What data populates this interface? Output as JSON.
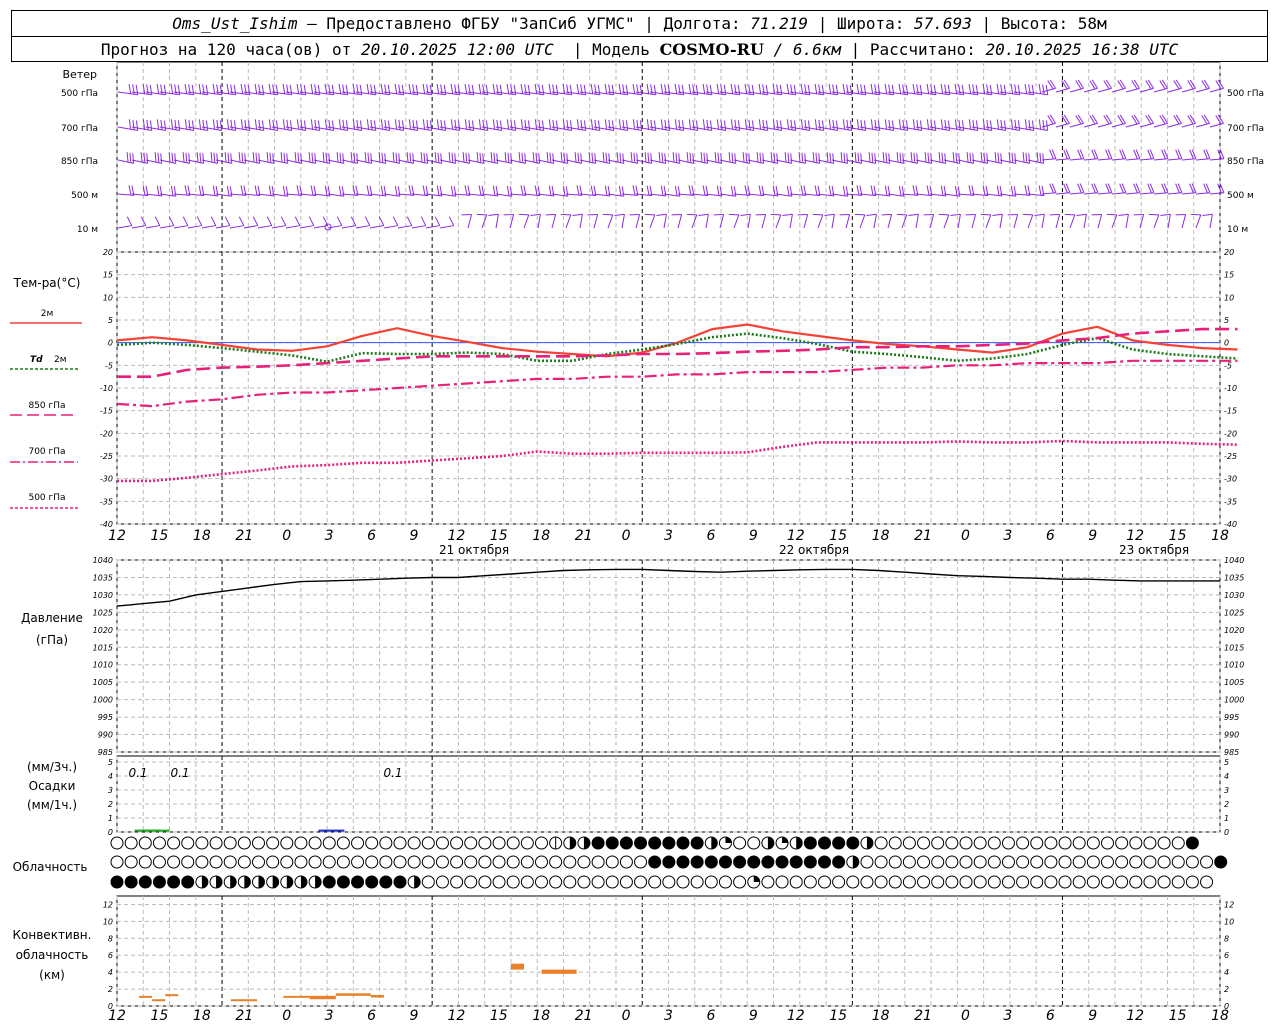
{
  "header": {
    "station": "Oms_Ust_Ishim",
    "provider": " – Предоставлено ФГБУ \"ЗапСиб УГМС\" | Долгота: ",
    "lon": "71.219",
    "lat_label": " | Широта: ",
    "lat": "57.693",
    "alt_label": " | Высота: ",
    "alt": "58м",
    "forecast_label": "Прогноз на 120 часа(ов) от ",
    "init": "20.10.2025 12:00 UTC",
    "model_label": "  | Модель ",
    "model": "COSMO-RU",
    "res": " / 6.6км",
    "calc_label": " | Рассчитано: ",
    "calc": "20.10.2025 16:38 UTC"
  },
  "labels": {
    "wind": "Ветер",
    "wind_levels": [
      "500 гПа",
      "700 гПа",
      "850 гПа",
      "500 м",
      "10  м"
    ],
    "temp_title": "Тем-ра(°C)",
    "t2m": "2м",
    "td_a": "Td",
    "td_b": "2м",
    "l850": "850 гПа",
    "l700": "700 гПа",
    "l500": "500 гПа",
    "pres_a": "Давление",
    "pres_b": "(гПа)",
    "precip_a": "(мм/3ч.)",
    "precip_b": "Осадки",
    "precip_c": "(мм/1ч.)",
    "cloud": "Облачность",
    "conv_a": "Конвективн.",
    "conv_b": "облачность",
    "conv_c": "(км)",
    "days": [
      "21 октября",
      "22 октября",
      "23 октября"
    ],
    "hour_ticks": [
      "12",
      "15",
      "18",
      "21",
      "0",
      "3",
      "6",
      "9",
      "12",
      "15",
      "18",
      "21",
      "0",
      "3",
      "6",
      "9",
      "12",
      "15",
      "18",
      "21",
      "0",
      "3",
      "6",
      "9",
      "12",
      "15",
      "18"
    ]
  },
  "colors": {
    "t2m": "#f44336",
    "td": "#1b7a1b",
    "t850": "#e8207a",
    "t700": "#e8207a",
    "t500": "#e8207a",
    "wind": "#8a2be2",
    "precip_green": "#22aa22",
    "precip_blue": "#2233cc",
    "conv": "#e8812a",
    "zero_line": "#3355ff"
  },
  "chart_data": [
    {
      "type": "line",
      "title": "Тем-ра(°C)",
      "x_hours": [
        0,
        3,
        6,
        9,
        12,
        15,
        18,
        21,
        24,
        27,
        30,
        33,
        36,
        39,
        42,
        45,
        48,
        51,
        54,
        57,
        60,
        63,
        66,
        69,
        72,
        75,
        78,
        81,
        84,
        87,
        90,
        93,
        96,
        99,
        102,
        105,
        108,
        111,
        114,
        117,
        120,
        123,
        126
      ],
      "ylim": [
        -40,
        20
      ],
      "yticks": [
        20,
        15,
        10,
        5,
        0,
        -5,
        -10,
        -15,
        -20,
        -25,
        -30,
        -35,
        -40
      ],
      "series": [
        {
          "name": "2м",
          "style": "solid",
          "values": [
            0.5,
            1.2,
            0.5,
            -0.5,
            -1.5,
            -1.8,
            -0.8,
            1.5,
            3.2,
            1.5,
            0.2,
            -1.2,
            -2,
            -2.5,
            -3,
            -2.2,
            0,
            3,
            4,
            2.5,
            1.5,
            0.5,
            -0.3,
            -0.8,
            -1.5,
            -2.2,
            -1,
            2,
            3.5,
            0.5,
            -0.5,
            -1.2,
            -1.5
          ]
        },
        {
          "name": "Td 2м",
          "style": "dotted",
          "values": [
            -0.5,
            0,
            -0.5,
            -1.2,
            -2,
            -2.8,
            -4.2,
            -2.3,
            -2.5,
            -2.5,
            -2.2,
            -2.5,
            -4,
            -4,
            -2.5,
            -1.5,
            -0.3,
            1.2,
            2,
            1,
            -0.3,
            -2,
            -2.5,
            -3.2,
            -4,
            -3.5,
            -2.5,
            -0.5,
            1,
            -1.5,
            -2.5,
            -3,
            -3.5
          ]
        },
        {
          "name": "850 гПа",
          "style": "dashed",
          "values": [
            -7.5,
            -7.5,
            -6,
            -5.5,
            -5.3,
            -5,
            -4.5,
            -4,
            -3.5,
            -3,
            -3,
            -3,
            -3,
            -3,
            -2.8,
            -2.5,
            -2.5,
            -2.3,
            -2,
            -1.8,
            -1.5,
            -1,
            -1,
            -0.8,
            -0.8,
            -0.5,
            -0.2,
            0.5,
            1,
            2,
            2.5,
            3,
            3
          ]
        },
        {
          "name": "700 гПа",
          "style": "dashdot",
          "values": [
            -13.5,
            -14,
            -13,
            -12.5,
            -11.5,
            -11,
            -11,
            -10.5,
            -10,
            -9.5,
            -9,
            -8.5,
            -8,
            -8,
            -7.5,
            -7.5,
            -7,
            -7,
            -6.5,
            -6.5,
            -6.5,
            -6,
            -5.5,
            -5.5,
            -5,
            -5,
            -4.5,
            -4.5,
            -4.5,
            -4,
            -4,
            -4,
            -4
          ]
        },
        {
          "name": "500 гПа",
          "style": "dotted",
          "values": [
            -30.5,
            -30.5,
            -29.8,
            -29,
            -28.2,
            -27.3,
            -27,
            -26.5,
            -26.5,
            -26,
            -25.5,
            -25,
            -24,
            -24.5,
            -24.5,
            -24.3,
            -24.3,
            -24.3,
            -24.2,
            -23,
            -22,
            -22,
            -22,
            -22,
            -21.8,
            -22,
            -22,
            -21.7,
            -22,
            -22,
            -22,
            -22.3,
            -22.5
          ]
        }
      ]
    },
    {
      "type": "line",
      "title": "Давление",
      "ylabel": "(гПа)",
      "ylim": [
        985,
        1040
      ],
      "yticks": [
        1040,
        1035,
        1030,
        1025,
        1020,
        1015,
        1010,
        1005,
        1000,
        995,
        990,
        985
      ],
      "x_hours": [
        0,
        3,
        6,
        9,
        12,
        15,
        18,
        21,
        24,
        27,
        30,
        33,
        36,
        39,
        42,
        45,
        48,
        51,
        54,
        57,
        60,
        63,
        66,
        69,
        72,
        75,
        78,
        81,
        84,
        87,
        90,
        93,
        96,
        99,
        102,
        105,
        108,
        111,
        114,
        117,
        120,
        123,
        126
      ],
      "values": [
        1026.8,
        1027.5,
        1028.2,
        1030,
        1031,
        1032,
        1033,
        1033.8,
        1034,
        1034.2,
        1034.5,
        1034.8,
        1035,
        1035,
        1035.5,
        1036,
        1036.5,
        1037,
        1037.2,
        1037.3,
        1037.3,
        1037,
        1036.7,
        1036.5,
        1036.8,
        1037,
        1037.2,
        1037.3,
        1037.3,
        1037,
        1036.5,
        1036,
        1035.5,
        1035.3,
        1035,
        1034.8,
        1034.5,
        1034.5,
        1034.2,
        1034,
        1034,
        1034,
        1034
      ]
    },
    {
      "type": "bar",
      "title": "Осадки",
      "ylim": [
        0,
        5
      ],
      "yticks": [
        5,
        4,
        3,
        2,
        1,
        0
      ],
      "values": [
        {
          "hour": 3.5,
          "value": 0.1,
          "label": "0.1",
          "color": "green"
        },
        {
          "hour": 4.5,
          "value": 0.1,
          "label": "0.1",
          "color": "green"
        },
        {
          "hour": 24.5,
          "value": 0.1,
          "label": "0.1",
          "color": "blue"
        }
      ]
    },
    {
      "type": "bar",
      "title": "Конвективн. облачность",
      "ylabel": "(км)",
      "ylim": [
        0,
        13
      ],
      "yticks": [
        12,
        10,
        8,
        6,
        4,
        2,
        0
      ],
      "segments": [
        {
          "from": 2.5,
          "to": 4.0,
          "base": 1.0,
          "top": 1.2
        },
        {
          "from": 4.0,
          "to": 5.5,
          "base": 0.6,
          "top": 0.8
        },
        {
          "from": 5.5,
          "to": 7.0,
          "base": 1.2,
          "top": 1.4
        },
        {
          "from": 13.0,
          "to": 16.0,
          "base": 0.6,
          "top": 0.8
        },
        {
          "from": 19.0,
          "to": 22.0,
          "base": 1.0,
          "top": 1.2
        },
        {
          "from": 22.0,
          "to": 25.0,
          "base": 0.8,
          "top": 1.2
        },
        {
          "from": 25.0,
          "to": 29.0,
          "base": 1.2,
          "top": 1.5
        },
        {
          "from": 29.0,
          "to": 30.5,
          "base": 1.0,
          "top": 1.3
        },
        {
          "from": 45.0,
          "to": 46.5,
          "base": 4.3,
          "top": 5.0
        },
        {
          "from": 48.5,
          "to": 52.5,
          "base": 3.8,
          "top": 4.3
        }
      ]
    }
  ],
  "wind_rows": 5,
  "cloud_rows": [
    "OOOOOOOOOOOOOOOOOOOOOOOOOOOOOOODHHFFFFFFFFHQOOHQHFFFFHOOOOOOOOOOOOOOOOOOOOOOF",
    "OOOOOOOOOOOOOOOOOOOOOOOOOOOOOOOOOOOOOOFFFFFFFFFFFFFFHOOOOOOOOOOOOOOOOOOOOOOOOOF",
    "FFFFFFHHHHHHHHHFFFFFFHOOOOOOOOOOOOOOOOOOOOOOOQOOOOOOOOOOOOOOOOOOOOOOOOOOOOOOOO"
  ]
}
